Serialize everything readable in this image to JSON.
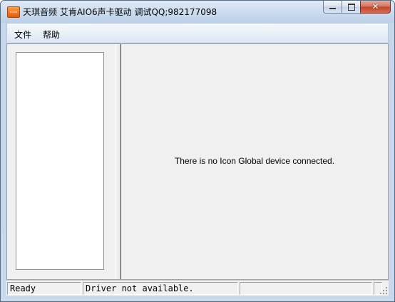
{
  "window": {
    "title": "天琪音频 艾肯AIO6声卡驱动 调试QQ;982177098",
    "icon_label": "ICON",
    "close_glyph": "✕"
  },
  "menu": {
    "items": [
      {
        "label": "文件"
      },
      {
        "label": "帮助"
      }
    ]
  },
  "main": {
    "message": "There is no Icon Global device connected."
  },
  "statusbar": {
    "panes": [
      {
        "text": "Ready"
      },
      {
        "text": "Driver not available."
      },
      {
        "text": ""
      },
      {
        "text": ""
      }
    ]
  },
  "colors": {
    "titlebar": "#c9daee",
    "client_background": "#f0f0f0",
    "close_button": "#c2432a"
  }
}
